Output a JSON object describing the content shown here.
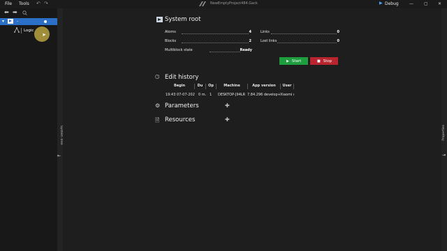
{
  "titlebar": {
    "menu_file": "File",
    "menu_tools": "Tools",
    "project_title": "NewEmptyProject484.Gack",
    "debug_label": "Debug",
    "icons": [
      "undo-icon",
      "redo-icon",
      "app-logo",
      "debug-icon",
      "minimize-icon",
      "maximize-icon",
      "close-icon"
    ]
  },
  "tree": {
    "root_label": "-",
    "child_label": "Logic"
  },
  "side_tabs": {
    "left_label": "System Tree",
    "right_label": "Properties"
  },
  "system_root": {
    "title": "System root",
    "props_left": [
      {
        "label": "Atoms",
        "value": "4"
      },
      {
        "label": "Blocks",
        "value": "2"
      },
      {
        "label": "Multiblock state",
        "value": "Ready"
      }
    ],
    "props_right": [
      {
        "label": "Links",
        "value": "0"
      },
      {
        "label": "Lost links",
        "value": "0"
      }
    ],
    "start_label": "Start",
    "stop_label": "Stop",
    "start_color": "#1e9e3f",
    "stop_color": "#b8252e"
  },
  "edit_history": {
    "title": "Edit history",
    "columns": [
      "Begin",
      "Du",
      "Op",
      "Machine",
      "App version",
      "User"
    ],
    "rows": [
      [
        "19:43 07-07-2020",
        "0 m.",
        "1",
        "DESKTOP-J94LR",
        "7.84.296 develop+fi",
        "Xiaomi c"
      ]
    ]
  },
  "parameters": {
    "title": "Parameters"
  },
  "resources": {
    "title": "Resources"
  },
  "colors": {
    "accent": "#2c6fc7",
    "background": "#1e1e1e",
    "panel": "#181818"
  }
}
